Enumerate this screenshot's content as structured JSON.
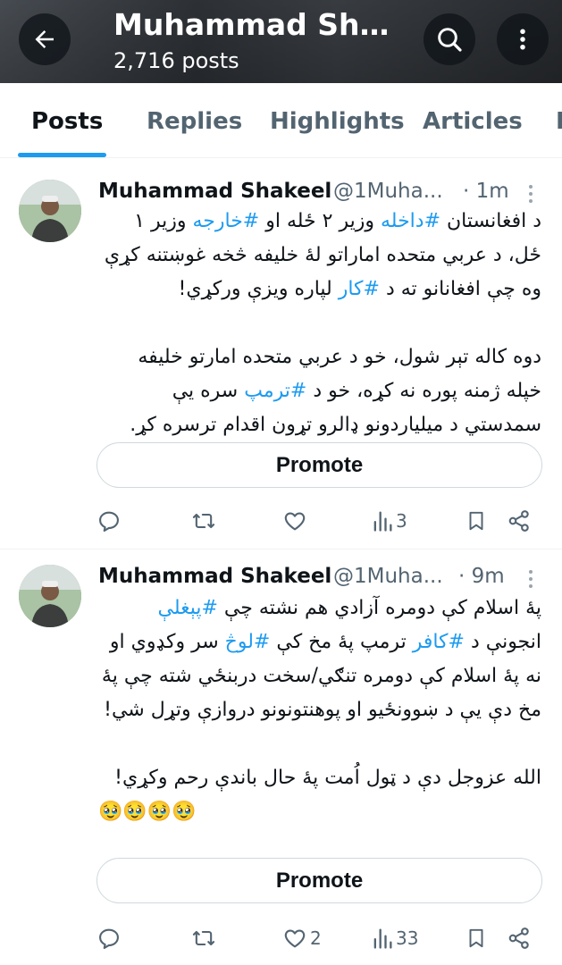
{
  "header": {
    "back_icon": "arrow-left-icon",
    "title": "Muhammad Shak...",
    "posts_count": "2,716 posts",
    "search_icon": "search-icon",
    "more_icon": "more-vertical-icon"
  },
  "tabs": [
    {
      "label": "Posts",
      "active": true
    },
    {
      "label": "Replies",
      "active": false
    },
    {
      "label": "Highlights",
      "active": false
    },
    {
      "label": "Articles",
      "active": false
    },
    {
      "label": "M",
      "active": false
    }
  ],
  "posts": [
    {
      "name": "Muhammad Shakeel",
      "handle": "@1Muha...",
      "time": "· 1m",
      "paragraphs": [
        [
          "د افغانستان ",
          "#داخله",
          " وزیر ۲ ځله او ",
          "#خارجه",
          " وزیر ۱ ځل، د عربي متحده اماراتو لهٔ خلیفه څخه غوښتنه کړې وه چې افغانانو ته د ",
          "#کار",
          " لپاره ویزې ورکړي!"
        ],
        [
          "دوه کاله تېر شول، خو د عربي متحده امارتو خلیفه خپله ژمنه پوره نه کړه، خو د ",
          "#ترمپ",
          " سره یې سمدستي د میلیاردونو ډالرو تړون اقدام ترسره کړ."
        ]
      ],
      "promote_label": "Promote",
      "actions": {
        "replies": "",
        "reposts": "",
        "likes": "",
        "views": "3"
      }
    },
    {
      "name": "Muhammad Shakeel",
      "handle": "@1Muha...",
      "time": "· 9m",
      "paragraphs": [
        [
          "پهٔ اسلام کې دومره آزادي هم نشته چې ",
          "#پېغلې",
          " انجونې د ",
          "#کافر",
          " ترمپ پهٔ مخ کې ",
          "#لوڅ",
          " سر وکډوي او نه پهٔ اسلام کې دومره تنګي/سخت دربنځي شته چې پهٔ مخ دې یې د ښوونځیو او پوهنتونونو دروازې وتړل شي!"
        ],
        [
          "الله عزوجل دې د ټول اُمت پهٔ حال باندې رحم وکړي!",
          "🥹🥹🥹🥹"
        ]
      ],
      "promote_label": "Promote",
      "actions": {
        "replies": "",
        "reposts": "",
        "likes": "2",
        "views": "33"
      }
    }
  ],
  "colors": {
    "accent": "#1d9bf0",
    "text": "#0f1419",
    "muted": "#536471",
    "border": "#cfd9de"
  }
}
